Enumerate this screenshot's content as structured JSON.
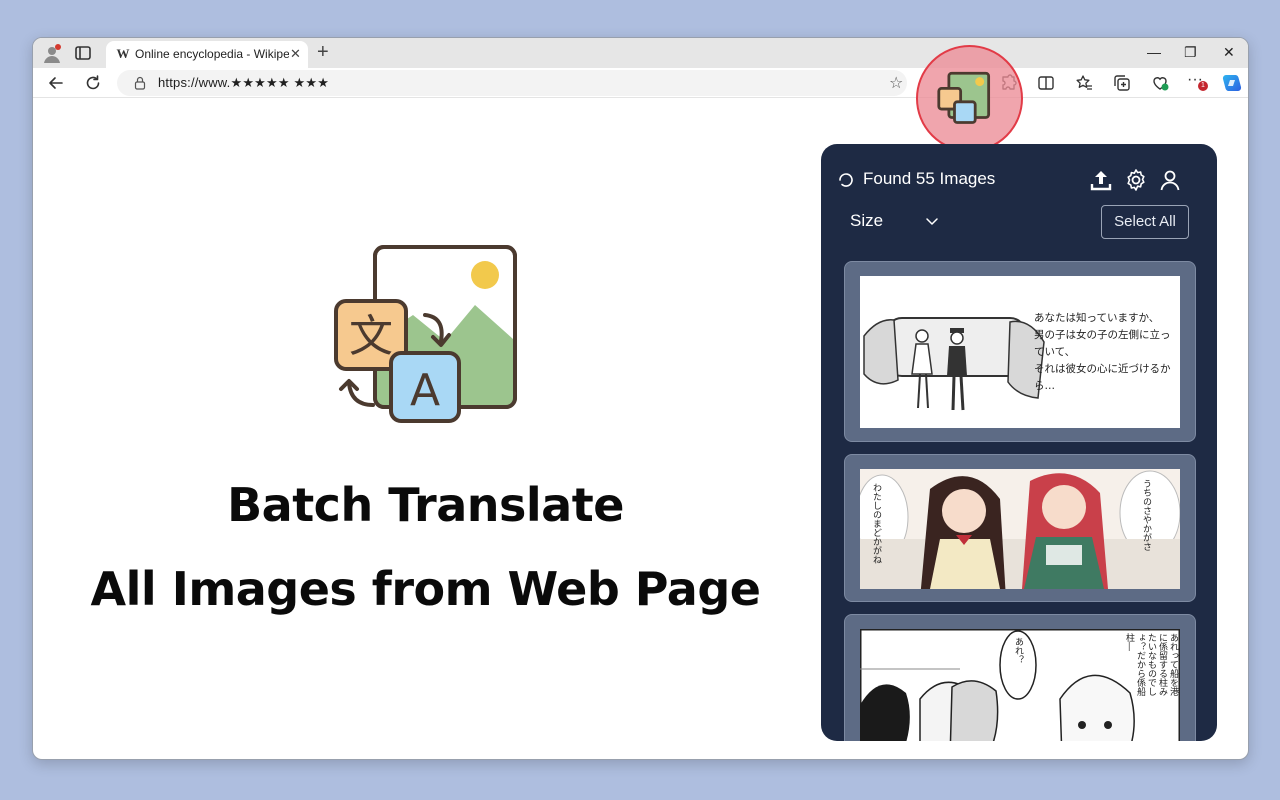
{
  "browser": {
    "tab_title": "Online encyclopedia - Wikipedia",
    "tab_close": "✕",
    "new_tab": "+",
    "favicon": "W",
    "url": "https://www.★★★★★  ★★★",
    "window_controls": {
      "minimize": "—",
      "restore": "❐",
      "close": "✕"
    },
    "notification_badge": "1",
    "icons": [
      "profile-icon",
      "tab-actions-icon",
      "back-icon",
      "reload-icon",
      "lock-icon",
      "star-icon",
      "extension-icon",
      "split-screen-icon",
      "favorites-icon",
      "collections-icon",
      "browser-essentials-icon",
      "more-icon",
      "copilot-icon"
    ]
  },
  "hero": {
    "line1": "Batch Translate",
    "line2": "All Images from Web Page",
    "logo_glyph_source": "文",
    "logo_glyph_target": "A"
  },
  "panel": {
    "found_text": "Found 55 Images",
    "sort_label": "Size",
    "select_all": "Select All",
    "images": [
      {
        "name": "manga-page-1",
        "caption_lines": [
          "あなたは知っていますか、",
          "男の子は女の子の左側に立っ",
          "ていて、",
          "それは彼女の心に近づけるか",
          "ら…"
        ]
      },
      {
        "name": "manga-page-2",
        "bubbles": [
          "わたしのまどかがね",
          "うちのさやかがさ"
        ]
      },
      {
        "name": "manga-page-3",
        "bubbles": [
          "あれ？",
          "あれって船を港に係留する柱みたいなものでしょ？だから係船柱―"
        ]
      }
    ]
  },
  "colors": {
    "page_background": "#aebedf",
    "panel_background": "#1e2a44",
    "card_background": "#5d6b85",
    "highlight_ring": "#e23b47",
    "logo_orange": "#f6c98f",
    "logo_blue": "#a9d8f5",
    "logo_green": "#9cc58e",
    "logo_sun": "#f2c94c"
  }
}
